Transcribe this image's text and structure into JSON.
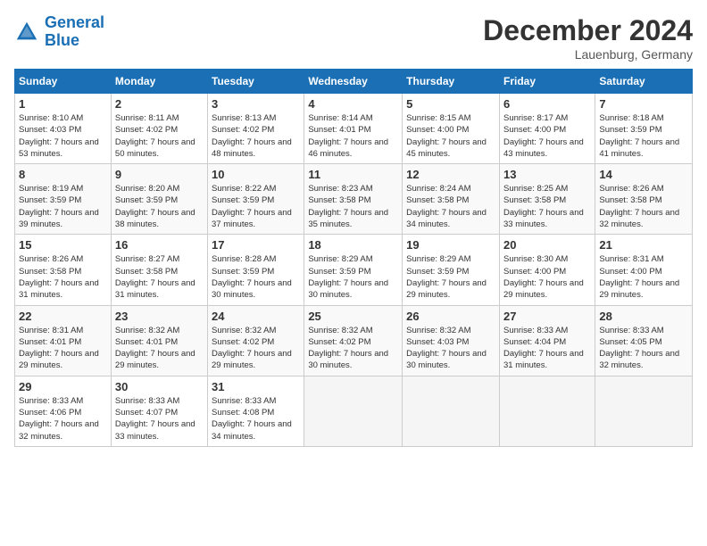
{
  "header": {
    "logo_line1": "General",
    "logo_line2": "Blue",
    "month": "December 2024",
    "location": "Lauenburg, Germany"
  },
  "days_of_week": [
    "Sunday",
    "Monday",
    "Tuesday",
    "Wednesday",
    "Thursday",
    "Friday",
    "Saturday"
  ],
  "weeks": [
    [
      {
        "day": "1",
        "sunrise": "8:10 AM",
        "sunset": "4:03 PM",
        "daylight": "7 hours and 53 minutes."
      },
      {
        "day": "2",
        "sunrise": "8:11 AM",
        "sunset": "4:02 PM",
        "daylight": "7 hours and 50 minutes."
      },
      {
        "day": "3",
        "sunrise": "8:13 AM",
        "sunset": "4:02 PM",
        "daylight": "7 hours and 48 minutes."
      },
      {
        "day": "4",
        "sunrise": "8:14 AM",
        "sunset": "4:01 PM",
        "daylight": "7 hours and 46 minutes."
      },
      {
        "day": "5",
        "sunrise": "8:15 AM",
        "sunset": "4:00 PM",
        "daylight": "7 hours and 45 minutes."
      },
      {
        "day": "6",
        "sunrise": "8:17 AM",
        "sunset": "4:00 PM",
        "daylight": "7 hours and 43 minutes."
      },
      {
        "day": "7",
        "sunrise": "8:18 AM",
        "sunset": "3:59 PM",
        "daylight": "7 hours and 41 minutes."
      }
    ],
    [
      {
        "day": "8",
        "sunrise": "8:19 AM",
        "sunset": "3:59 PM",
        "daylight": "7 hours and 39 minutes."
      },
      {
        "day": "9",
        "sunrise": "8:20 AM",
        "sunset": "3:59 PM",
        "daylight": "7 hours and 38 minutes."
      },
      {
        "day": "10",
        "sunrise": "8:22 AM",
        "sunset": "3:59 PM",
        "daylight": "7 hours and 37 minutes."
      },
      {
        "day": "11",
        "sunrise": "8:23 AM",
        "sunset": "3:58 PM",
        "daylight": "7 hours and 35 minutes."
      },
      {
        "day": "12",
        "sunrise": "8:24 AM",
        "sunset": "3:58 PM",
        "daylight": "7 hours and 34 minutes."
      },
      {
        "day": "13",
        "sunrise": "8:25 AM",
        "sunset": "3:58 PM",
        "daylight": "7 hours and 33 minutes."
      },
      {
        "day": "14",
        "sunrise": "8:26 AM",
        "sunset": "3:58 PM",
        "daylight": "7 hours and 32 minutes."
      }
    ],
    [
      {
        "day": "15",
        "sunrise": "8:26 AM",
        "sunset": "3:58 PM",
        "daylight": "7 hours and 31 minutes."
      },
      {
        "day": "16",
        "sunrise": "8:27 AM",
        "sunset": "3:58 PM",
        "daylight": "7 hours and 31 minutes."
      },
      {
        "day": "17",
        "sunrise": "8:28 AM",
        "sunset": "3:59 PM",
        "daylight": "7 hours and 30 minutes."
      },
      {
        "day": "18",
        "sunrise": "8:29 AM",
        "sunset": "3:59 PM",
        "daylight": "7 hours and 30 minutes."
      },
      {
        "day": "19",
        "sunrise": "8:29 AM",
        "sunset": "3:59 PM",
        "daylight": "7 hours and 29 minutes."
      },
      {
        "day": "20",
        "sunrise": "8:30 AM",
        "sunset": "4:00 PM",
        "daylight": "7 hours and 29 minutes."
      },
      {
        "day": "21",
        "sunrise": "8:31 AM",
        "sunset": "4:00 PM",
        "daylight": "7 hours and 29 minutes."
      }
    ],
    [
      {
        "day": "22",
        "sunrise": "8:31 AM",
        "sunset": "4:01 PM",
        "daylight": "7 hours and 29 minutes."
      },
      {
        "day": "23",
        "sunrise": "8:32 AM",
        "sunset": "4:01 PM",
        "daylight": "7 hours and 29 minutes."
      },
      {
        "day": "24",
        "sunrise": "8:32 AM",
        "sunset": "4:02 PM",
        "daylight": "7 hours and 29 minutes."
      },
      {
        "day": "25",
        "sunrise": "8:32 AM",
        "sunset": "4:02 PM",
        "daylight": "7 hours and 30 minutes."
      },
      {
        "day": "26",
        "sunrise": "8:32 AM",
        "sunset": "4:03 PM",
        "daylight": "7 hours and 30 minutes."
      },
      {
        "day": "27",
        "sunrise": "8:33 AM",
        "sunset": "4:04 PM",
        "daylight": "7 hours and 31 minutes."
      },
      {
        "day": "28",
        "sunrise": "8:33 AM",
        "sunset": "4:05 PM",
        "daylight": "7 hours and 32 minutes."
      }
    ],
    [
      {
        "day": "29",
        "sunrise": "8:33 AM",
        "sunset": "4:06 PM",
        "daylight": "7 hours and 32 minutes."
      },
      {
        "day": "30",
        "sunrise": "8:33 AM",
        "sunset": "4:07 PM",
        "daylight": "7 hours and 33 minutes."
      },
      {
        "day": "31",
        "sunrise": "8:33 AM",
        "sunset": "4:08 PM",
        "daylight": "7 hours and 34 minutes."
      },
      null,
      null,
      null,
      null
    ]
  ]
}
